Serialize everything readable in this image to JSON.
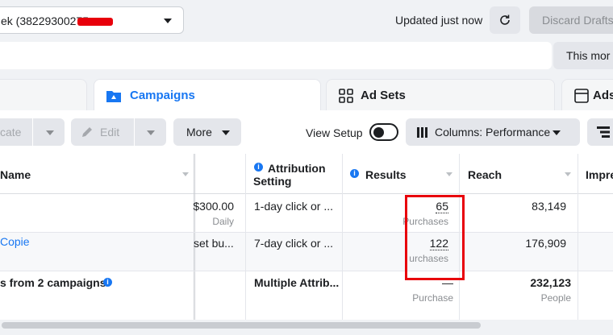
{
  "account": {
    "name": "ek (38229300275"
  },
  "header": {
    "updated": "Updated just now",
    "discard": "Discard Drafts",
    "date_range": "This mor"
  },
  "tabs": [
    {
      "label": ""
    },
    {
      "label": "Campaigns"
    },
    {
      "label": "Ad Sets"
    },
    {
      "label": "Ads"
    }
  ],
  "toolbar": {
    "create": "cate",
    "edit": "Edit",
    "more": "More",
    "view_setup": "View Setup",
    "columns": "Columns: Performance"
  },
  "table": {
    "headers": {
      "name": "Name",
      "attribution": "Attribution Setting",
      "results": "Results",
      "reach": "Reach",
      "impressions": "Impre"
    },
    "rows": [
      {
        "name": "",
        "budget": "$300.00",
        "budget_sub": "Daily",
        "attribution": "1-day click or ...",
        "results": "65",
        "results_sub": "Purchases",
        "reach": "83,149"
      },
      {
        "name": "Copie",
        "budget": "set bu...",
        "budget_sub": "",
        "attribution": "7-day click or ...",
        "results": "122",
        "results_sub": "urchases",
        "reach": "176,909"
      }
    ],
    "summary": {
      "name": "s from 2 campaigns",
      "attribution": "Multiple Attrib...",
      "results": "—",
      "results_sub": "Purchase",
      "reach": "232,123",
      "reach_sub": "People"
    }
  },
  "colors": {
    "accent": "#1877f2",
    "highlight": "#e8000b"
  }
}
